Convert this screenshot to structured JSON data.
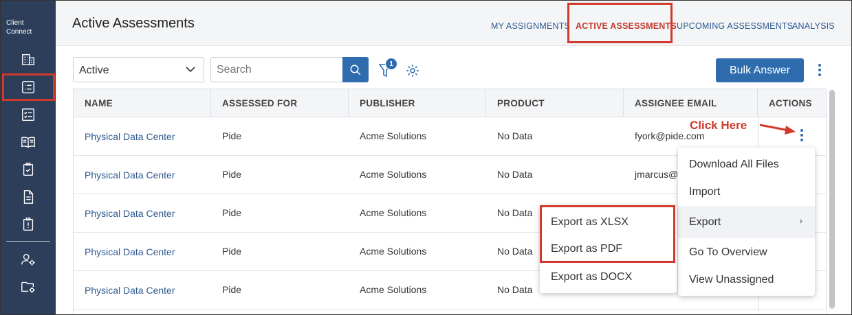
{
  "sidebar": {
    "brand_line1": "Client",
    "brand_line2": "Connect",
    "items": [
      {
        "icon": "building-icon"
      },
      {
        "icon": "list-icon",
        "active": true
      },
      {
        "icon": "checklist-icon"
      },
      {
        "icon": "book-icon"
      },
      {
        "icon": "clipboard-check-icon"
      },
      {
        "icon": "document-icon"
      },
      {
        "icon": "alert-clipboard-icon"
      },
      {
        "icon": "user-settings-icon"
      },
      {
        "icon": "folder-settings-icon"
      }
    ]
  },
  "header": {
    "title": "Active Assessments",
    "tabs": [
      {
        "label": "MY ASSIGNMENTS"
      },
      {
        "label": "ACTIVE ASSESSMENTS",
        "active": true
      },
      {
        "label": "UPCOMING ASSESSMENTS"
      },
      {
        "label": "ANALYSIS"
      }
    ]
  },
  "toolbar": {
    "status_select": "Active",
    "search_placeholder": "Search",
    "filter_badge": "1",
    "bulk_answer_label": "Bulk Answer"
  },
  "table": {
    "columns": [
      "NAME",
      "ASSESSED FOR",
      "PUBLISHER",
      "PRODUCT",
      "ASSIGNEE EMAIL",
      "ACTIONS"
    ],
    "rows": [
      {
        "name": "Physical Data Center",
        "assessed_for": "Pide",
        "publisher": "Acme Solutions",
        "product": "No Data",
        "email": "fyork@pide.com"
      },
      {
        "name": "Physical Data Center",
        "assessed_for": "Pide",
        "publisher": "Acme Solutions",
        "product": "No Data",
        "email": "jmarcus@"
      },
      {
        "name": "Physical Data Center",
        "assessed_for": "Pide",
        "publisher": "Acme Solutions",
        "product": "No Data",
        "email": ""
      },
      {
        "name": "Physical Data Center",
        "assessed_for": "Pide",
        "publisher": "Acme Solutions",
        "product": "No Data",
        "email": ""
      },
      {
        "name": "Physical Data Center",
        "assessed_for": "Pide",
        "publisher": "Acme Solutions",
        "product": "No Data",
        "email": ""
      }
    ]
  },
  "annotation": {
    "click_here": "Click Here",
    "color": "#d0392b"
  },
  "actions_menu": {
    "items": [
      "Download All Files",
      "Import",
      "Export",
      "Go To Overview",
      "View Unassigned"
    ],
    "submenu_arrow": "›"
  },
  "export_menu": {
    "items": [
      "Export as XLSX",
      "Export as PDF",
      "Export as DOCX"
    ]
  },
  "colors": {
    "sidebar": "#2d3e5a",
    "accent": "#2f6cae",
    "highlight": "#d0392b"
  }
}
